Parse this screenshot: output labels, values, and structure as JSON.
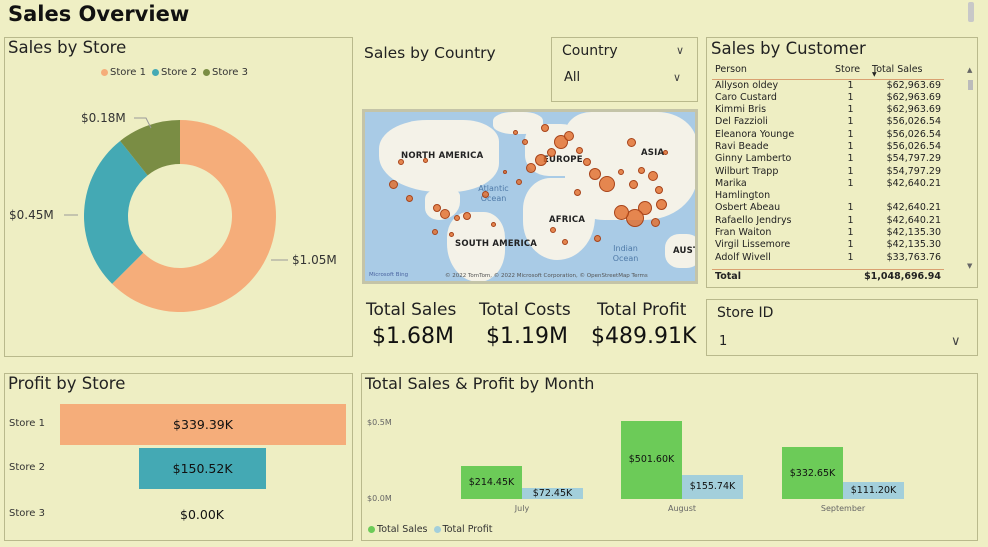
{
  "page": {
    "title": "Sales Overview"
  },
  "sales_by_store": {
    "title": "Sales by Store",
    "legend": [
      "Store 1",
      "Store 2",
      "Store 3"
    ],
    "labels": {
      "store1": "$1.05M",
      "store2": "$0.45M",
      "store3": "$0.18M"
    },
    "colors": {
      "store1": "#f5ad7a",
      "store2": "#44a9b4",
      "store3": "#7a8d44"
    }
  },
  "sales_by_country": {
    "title": "Sales by Country"
  },
  "country_slicer": {
    "label": "Country",
    "value": "All"
  },
  "map": {
    "labels": {
      "north_america": "NORTH AMERICA",
      "europe": "EUROPE",
      "asia": "ASIA",
      "africa": "AFRICA",
      "south_america": "SOUTH AMERICA",
      "australia": "AUST"
    },
    "oceans": {
      "atlantic": "Atlantic\nOcean",
      "indian": "Indian\nOcean"
    },
    "brand": "Microsoft Bing",
    "attribution": "© 2022 TomTom, © 2022 Microsoft Corporation, © OpenStreetMap  Terms"
  },
  "kpis": [
    {
      "label": "Total Sales",
      "value": "$1.68M"
    },
    {
      "label": "Total Costs",
      "value": "$1.19M"
    },
    {
      "label": "Total Profit",
      "value": "$489.91K"
    }
  ],
  "sales_by_customer": {
    "title": "Sales by Customer",
    "columns": [
      "Person",
      "Store",
      "Total Sales"
    ],
    "rows": [
      [
        "Allyson oldey",
        "1",
        "$62,963.69"
      ],
      [
        "Caro Custard",
        "1",
        "$62,963.69"
      ],
      [
        "Kimmi Bris",
        "1",
        "$62,963.69"
      ],
      [
        "Del Fazzioli",
        "1",
        "$56,026.54"
      ],
      [
        "Eleanora Younge",
        "1",
        "$56,026.54"
      ],
      [
        "Ravi Beade",
        "1",
        "$56,026.54"
      ],
      [
        "Ginny Lamberto",
        "1",
        "$54,797.29"
      ],
      [
        "Wilburt Trapp",
        "1",
        "$54,797.29"
      ],
      [
        "Marika",
        "1",
        "$42,640.21"
      ],
      [
        "Hamlington",
        "",
        ""
      ],
      [
        "Osbert Abeau",
        "1",
        "$42,640.21"
      ],
      [
        "Rafaello Jendrys",
        "1",
        "$42,640.21"
      ],
      [
        "Fran Waiton",
        "1",
        "$42,135.30"
      ],
      [
        "Virgil Lissemore",
        "1",
        "$42,135.30"
      ],
      [
        "Adolf Wivell",
        "1",
        "$33,763.76"
      ]
    ],
    "total_label": "Total",
    "total_value": "$1,048,696.94"
  },
  "store_slicer": {
    "label": "Store ID",
    "value": "1"
  },
  "profit_by_store": {
    "title": "Profit by Store",
    "bars": [
      {
        "label": "Store 1",
        "value_text": "$339.39K",
        "value": 339.39,
        "color": "#f5ad7a"
      },
      {
        "label": "Store 2",
        "value_text": "$150.52K",
        "value": 150.52,
        "color": "#44a9b4"
      },
      {
        "label": "Store 3",
        "value_text": "$0.00K",
        "value": 0.0,
        "color": "#7a8d44"
      }
    ]
  },
  "sales_profit_by_month": {
    "title": "Total Sales & Profit by Month",
    "y_ticks": [
      "$0.5M",
      "$0.0M"
    ],
    "legend": [
      "Total Sales",
      "Total Profit"
    ],
    "colors": {
      "sales": "#6ccb58",
      "profit": "#a3cfdb"
    },
    "months": [
      {
        "name": "July",
        "sales_text": "$214.45K",
        "profit_text": "$72.45K"
      },
      {
        "name": "August",
        "sales_text": "$501.60K",
        "profit_text": "$155.74K"
      },
      {
        "name": "September",
        "sales_text": "$332.65K",
        "profit_text": "$111.20K"
      }
    ]
  },
  "chart_data": [
    {
      "type": "pie",
      "title": "Sales by Store",
      "categories": [
        "Store 1",
        "Store 2",
        "Store 3"
      ],
      "values": [
        1.05,
        0.45,
        0.18
      ],
      "unit": "$M"
    },
    {
      "type": "bar",
      "title": "Profit by Store",
      "categories": [
        "Store 1",
        "Store 2",
        "Store 3"
      ],
      "values": [
        339.39,
        150.52,
        0.0
      ],
      "unit": "$K"
    },
    {
      "type": "bar",
      "title": "Total Sales & Profit by Month",
      "categories": [
        "July",
        "August",
        "September"
      ],
      "series": [
        {
          "name": "Total Sales",
          "values": [
            214.45,
            501.6,
            332.65
          ]
        },
        {
          "name": "Total Profit",
          "values": [
            72.45,
            155.74,
            111.2
          ]
        }
      ],
      "unit": "$K",
      "ylim": [
        0,
        500
      ]
    }
  ]
}
